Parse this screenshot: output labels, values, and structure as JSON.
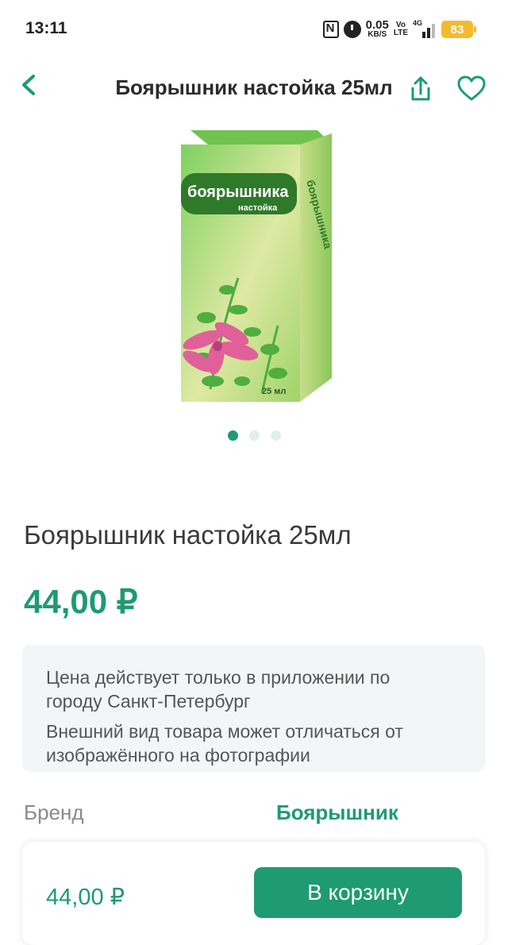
{
  "status_bar": {
    "time": "13:11",
    "net_speed_value": "0.05",
    "net_speed_unit": "KB/S",
    "volte_top": "Vo",
    "volte_bottom": "LTE",
    "signal_label": "4G",
    "battery": "83"
  },
  "header": {
    "title": "Боярышник настойка 25мл",
    "icons": [
      "chevron-left-icon",
      "share-icon",
      "heart-icon"
    ]
  },
  "product_image": {
    "box_brand": "боярышника",
    "box_subtitle": "настойка",
    "box_volume": "25 мл",
    "box_side_text": "боярышника",
    "colors": {
      "box_green": "#5cbf3a",
      "flower_pink": "#e0609a"
    }
  },
  "gallery": {
    "slides": 3,
    "active_index": 0
  },
  "product": {
    "title": "Боярышник настойка 25мл",
    "price": "44,00 ₽"
  },
  "notice": {
    "line1": "Цена действует только в приложении по городу Санкт-Петербург",
    "line2": "Внешний вид товара может отличаться от изображённого на фотографии"
  },
  "brand": {
    "label": "Бренд",
    "value": "Боярышник"
  },
  "buy_panel": {
    "price": "44,00 ₽",
    "cart_label": "В корзину"
  },
  "colors": {
    "accent": "#1e9b70",
    "notice_bg": "#f3f6f9"
  }
}
